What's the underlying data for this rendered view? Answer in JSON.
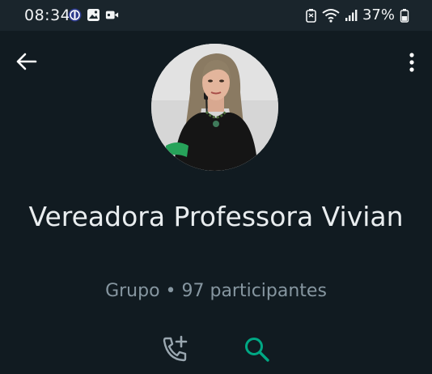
{
  "status_bar": {
    "time": "08:34",
    "battery": "37%"
  },
  "icons": {
    "back": "arrow-left-icon",
    "menu": "more-vertical-icon",
    "call": "add-call-icon",
    "search": "search-icon"
  },
  "profile": {
    "name": "Vereadora Professora Vivian",
    "subtitle": "Grupo • 97 participantes"
  },
  "colors": {
    "background": "#111b21",
    "accent": "#00a884",
    "text_primary": "#e9edef",
    "text_secondary": "#8696a0"
  }
}
